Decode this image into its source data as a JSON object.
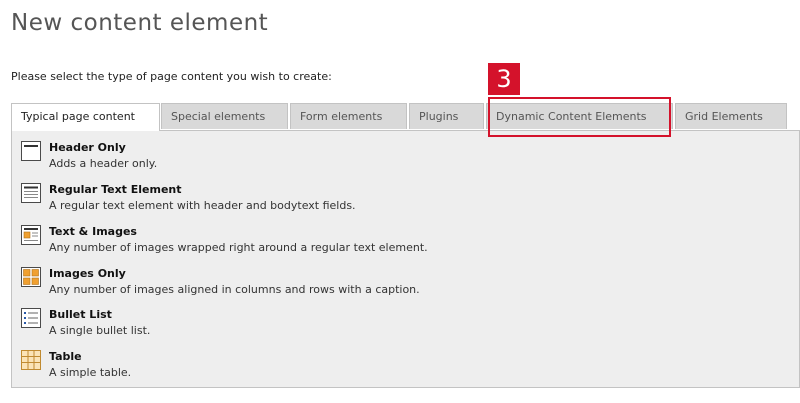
{
  "page": {
    "title": "New content element",
    "instruction": "Please select the type of page content you wish to create:"
  },
  "tabs": [
    {
      "label": "Typical page content",
      "active": true
    },
    {
      "label": "Special elements",
      "active": false
    },
    {
      "label": "Form elements",
      "active": false
    },
    {
      "label": "Plugins",
      "active": false
    },
    {
      "label": "Dynamic Content Elements",
      "active": false
    },
    {
      "label": "Grid Elements",
      "active": false
    }
  ],
  "items": [
    {
      "icon": "header-only-icon",
      "title": "Header Only",
      "description": "Adds a header only."
    },
    {
      "icon": "regular-text-icon",
      "title": "Regular Text Element",
      "description": "A regular text element with header and bodytext fields."
    },
    {
      "icon": "text-images-icon",
      "title": "Text & Images",
      "description": "Any number of images wrapped right around a regular text element."
    },
    {
      "icon": "images-only-icon",
      "title": "Images Only",
      "description": "Any number of images aligned in columns and rows with a caption."
    },
    {
      "icon": "bullet-list-icon",
      "title": "Bullet List",
      "description": "A single bullet list."
    },
    {
      "icon": "table-icon",
      "title": "Table",
      "description": "A simple table."
    }
  ],
  "callout": {
    "number": "3",
    "color": "#d4122b"
  }
}
